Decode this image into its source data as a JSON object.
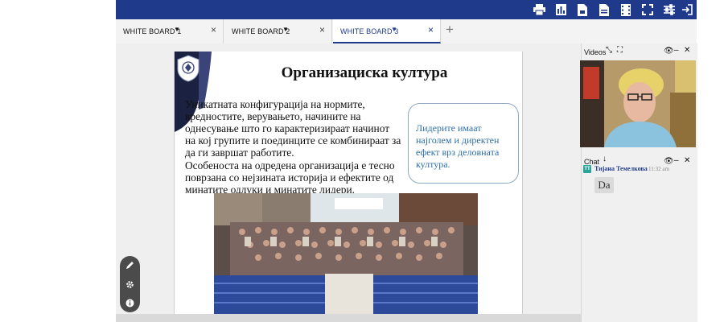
{
  "toolbar": {
    "icons": [
      "print-icon",
      "chart-icon",
      "document-icon",
      "file-icon",
      "film-icon",
      "fullscreen-icon",
      "settings-sliders-icon",
      "exit-icon"
    ],
    "accent": "#1f3a8a"
  },
  "tabs": [
    {
      "label": "WHITE BOARD 1",
      "active": false
    },
    {
      "label": "WHITE BOARD 2",
      "active": false
    },
    {
      "label": "WHITE BOARD 3",
      "active": true
    }
  ],
  "add_tab": "+",
  "slide": {
    "title": "Организациска култура",
    "paragraph1": "Уникатната конфигурација на нормите, вредностите, верувањето, начините на однесување што го карактеризираат начинот на кој групите и поединците се комбинираат за да ги завршат работите.",
    "paragraph2": "Особеноста на одредена организација е тесно поврзана со нејзината историја и ефектите од минатите одлуки и минатите лидери.",
    "callout": "Лидерите имаат најголем и директен ефект врз деловната култура."
  },
  "panel": {
    "videos_title": "Videos",
    "chat_title": "Chat",
    "chat": [
      {
        "initials": "TT",
        "user": "Тијана Темелкова",
        "time": "11:32 am",
        "message": "Da"
      }
    ]
  }
}
